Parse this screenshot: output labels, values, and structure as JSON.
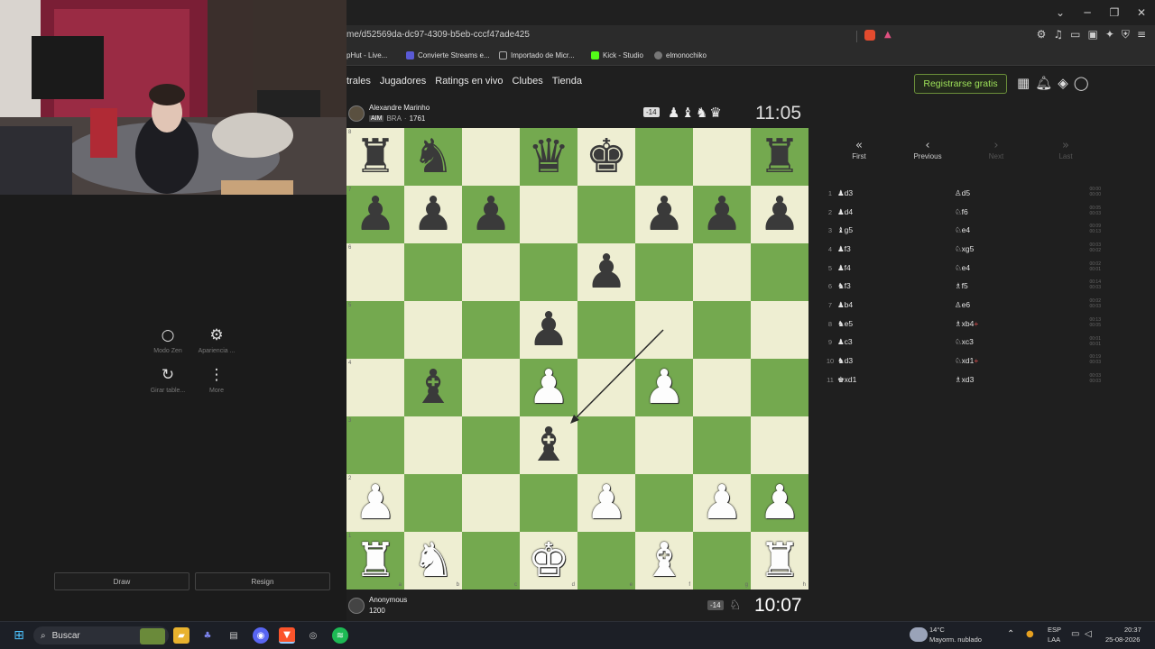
{
  "browser": {
    "url": "me/d52569da-dc97-4309-b5eb-cccf47ade425",
    "bookmarks": [
      {
        "label": "pHut - Live...",
        "color": "#444"
      },
      {
        "label": "Convierte Streams e...",
        "color": "#5a5ad6"
      },
      {
        "label": "Importado de Micr...",
        "color": "#888"
      },
      {
        "label": "Kick - Studio",
        "color": "#53fc18"
      },
      {
        "label": "elmonochiko",
        "color": "#777"
      }
    ]
  },
  "site": {
    "nav": [
      "trales",
      "Jugadores",
      "Ratings en vivo",
      "Clubes",
      "Tienda"
    ],
    "register_label": "Registrarse gratis"
  },
  "opponent": {
    "name": "Alexandre Marinho",
    "title": "AIM",
    "country": "BRA",
    "rating": "1761",
    "diff": "-14",
    "clock": "11:05"
  },
  "me": {
    "name": "Anonymous",
    "rating": "1200",
    "diff": "-14",
    "clock": "10:07"
  },
  "board": {
    "ranks": [
      "8",
      "7",
      "6",
      "5",
      "4",
      "3",
      "2",
      "1"
    ],
    "files": [
      "a",
      "b",
      "c",
      "d",
      "e",
      "f",
      "g",
      "h"
    ],
    "position": [
      [
        "r",
        "n",
        "",
        "q",
        "k",
        "",
        "",
        "r"
      ],
      [
        "p",
        "p",
        "p",
        "",
        "",
        "p",
        "p",
        "p"
      ],
      [
        "",
        "",
        "",
        "",
        "p",
        "",
        "",
        ""
      ],
      [
        "",
        "",
        "",
        "p",
        "",
        "",
        "",
        ""
      ],
      [
        "",
        "b",
        "",
        "P",
        "",
        "P",
        "",
        ""
      ],
      [
        "",
        "",
        "",
        "b",
        "",
        "",
        "",
        ""
      ],
      [
        "P",
        "",
        "",
        "",
        "P",
        "",
        "P",
        "P"
      ],
      [
        "R",
        "N",
        "",
        "K",
        "",
        "B",
        "",
        "R"
      ]
    ],
    "arrow": {
      "from": "f5",
      "to": "d3"
    }
  },
  "move_nav": {
    "first": "First",
    "previous": "Previous",
    "next": "Next",
    "last": "Last"
  },
  "moves": [
    {
      "n": "1",
      "w_icon": "♟",
      "w": "d3",
      "b_icon": "♙",
      "b": "d5",
      "t1": "00:00",
      "t2": "00:00"
    },
    {
      "n": "2",
      "w_icon": "♟",
      "w": "d4",
      "b_icon": "♘",
      "b": "f6",
      "t1": "00:05",
      "t2": "00:03"
    },
    {
      "n": "3",
      "w_icon": "♝",
      "w": "g5",
      "b_icon": "♘",
      "b": "e4",
      "t1": "00:09",
      "t2": "00:13"
    },
    {
      "n": "4",
      "w_icon": "♟",
      "w": "f3",
      "b_icon": "♘",
      "b": "xg5",
      "t1": "00:03",
      "t2": "00:02"
    },
    {
      "n": "5",
      "w_icon": "♟",
      "w": "f4",
      "b_icon": "♘",
      "b": "e4",
      "t1": "00:02",
      "t2": "00:01"
    },
    {
      "n": "6",
      "w_icon": "♞",
      "w": "f3",
      "b_icon": "♗",
      "b": "f5",
      "t1": "00:14",
      "t2": "00:03"
    },
    {
      "n": "7",
      "w_icon": "♟",
      "w": "b4",
      "b_icon": "♙",
      "b": "e6",
      "t1": "00:02",
      "t2": "00:03"
    },
    {
      "n": "8",
      "w_icon": "♞",
      "w": "e5",
      "b_icon": "♗",
      "b": "xb4",
      "b_check": "+",
      "t1": "00:13",
      "t2": "00:05"
    },
    {
      "n": "9",
      "w_icon": "♟",
      "w": "c3",
      "b_icon": "♘",
      "b": "xc3",
      "t1": "00:01",
      "t2": "00:01"
    },
    {
      "n": "10",
      "w_icon": "♞",
      "w": "d3",
      "b_icon": "♘",
      "b": "xd1",
      "b_check": "+",
      "t1": "00:19",
      "t2": "00:03"
    },
    {
      "n": "11",
      "w_icon": "♚",
      "w": "xd1",
      "b_icon": "♗",
      "b": "xd3",
      "t1": "00:03",
      "t2": "00:03"
    }
  ],
  "left_tools": [
    {
      "icon": "circle-icon",
      "label": "Modo Zen"
    },
    {
      "icon": "sliders-icon",
      "label": "Apariencia ..."
    },
    {
      "icon": "rotate-icon",
      "label": "Girar table..."
    },
    {
      "icon": "more-icon",
      "label": "More"
    }
  ],
  "actions": {
    "draw": "Draw",
    "resign": "Resign"
  },
  "taskbar": {
    "search": "Buscar",
    "weather_temp": "14°C",
    "weather_desc": "Mayorm. nublado",
    "lang1": "ESP",
    "lang2": "LAA",
    "time": "20:37",
    "date": "25-08-2026"
  }
}
